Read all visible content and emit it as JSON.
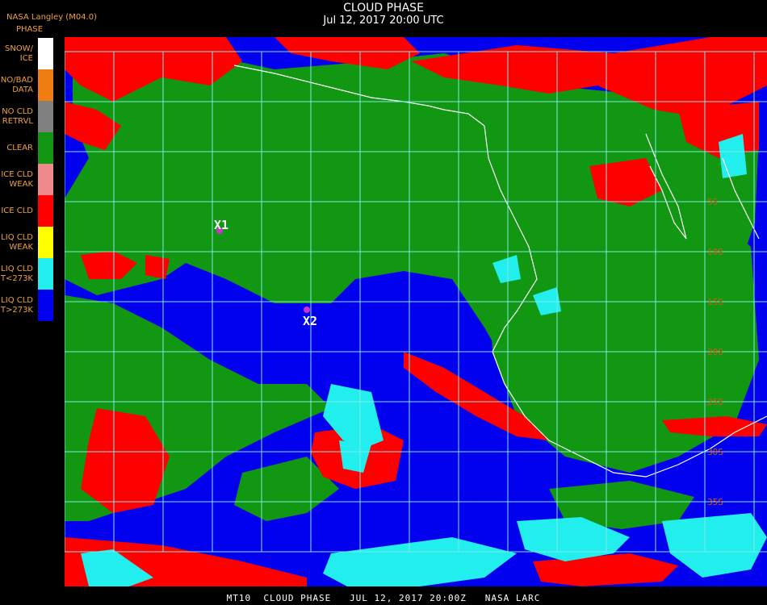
{
  "header": {
    "title": "CLOUD PHASE",
    "subtitle": "Jul 12, 2017 20:00 UTC"
  },
  "org_label": "NASA Langley (M04.0)",
  "legend": {
    "title": "PHASE",
    "items": [
      {
        "label": "SNOW/\nICE",
        "color": "#ffffff"
      },
      {
        "label": "NO/BAD\nDATA",
        "color": "#f07d12"
      },
      {
        "label": "NO CLD\nRETRVL",
        "color": "#808080"
      },
      {
        "label": "CLEAR",
        "color": "#119711"
      },
      {
        "label": "ICE CLD\nWEAK",
        "color": "#f08a8a"
      },
      {
        "label": "ICE CLD",
        "color": "#ff0000"
      },
      {
        "label": "LIQ CLD\nWEAK",
        "color": "#ffff00"
      },
      {
        "label": "LIQ CLD\nT<273K",
        "color": "#22eeee"
      },
      {
        "label": "LIQ CLD\nT>273K",
        "color": "#0000ee"
      }
    ]
  },
  "map": {
    "grid_color": "#7fe8e8",
    "coast_color": "#ffffff",
    "lat_label_color": "#d05a14",
    "lat_labels": [
      "5S",
      "10S",
      "15S",
      "20S",
      "25S",
      "30S",
      "35S"
    ],
    "markers": [
      {
        "label": "X1",
        "color": "#cc33cc"
      },
      {
        "label": "X2",
        "color": "#cc33cc"
      }
    ]
  },
  "footer": "MT10  CLOUD PHASE   JUL 12, 2017 20:00Z   NASA LARC"
}
